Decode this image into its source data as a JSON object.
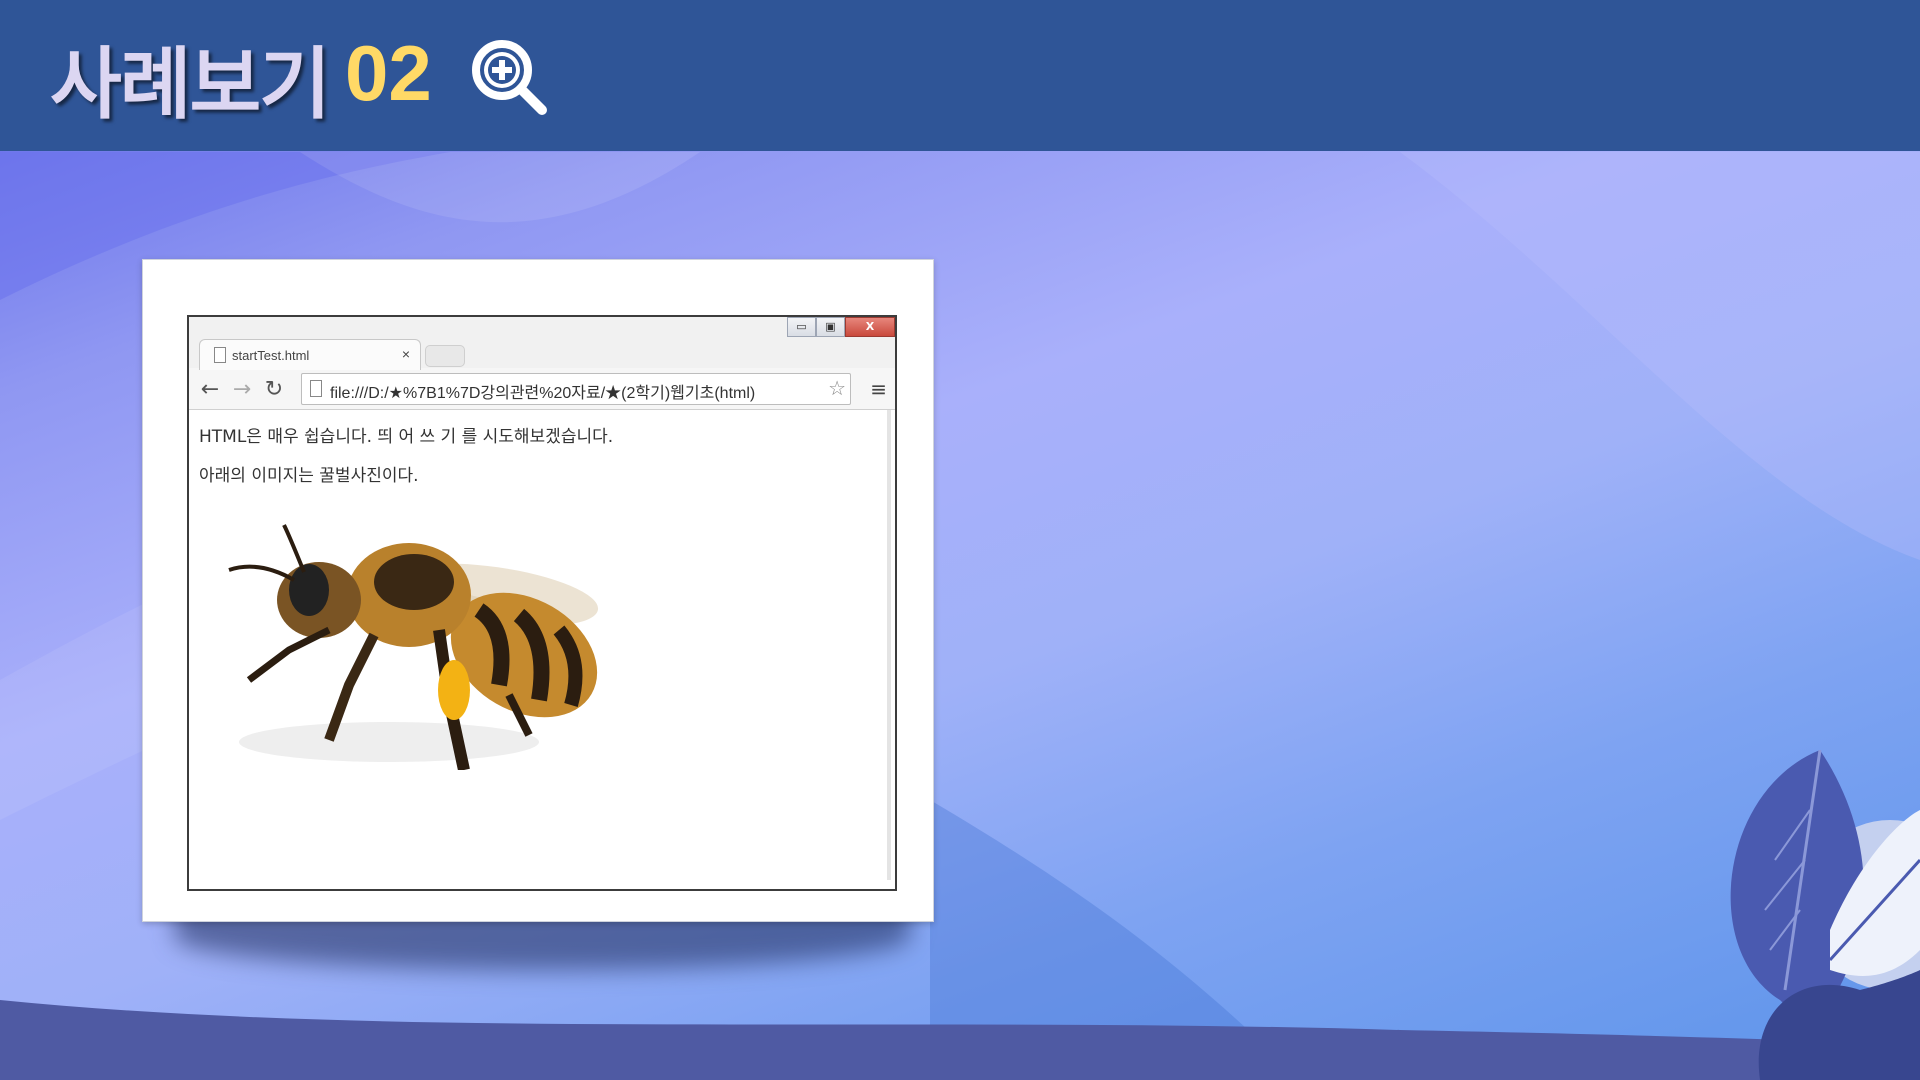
{
  "header": {
    "title": "사례보기",
    "number": "02",
    "colors": {
      "bar": "#2f5597",
      "title": "#dcd6f2",
      "number": "#ffd966"
    }
  },
  "browser": {
    "tab_title": "startTest.html",
    "tab_close": "×",
    "url": "file:///D:/★%7B1%7D강의관련%20자료/★(2학기)웹기초(html)",
    "window_buttons": {
      "minimize": "▭",
      "maximize": "▣",
      "close": "X"
    },
    "nav": {
      "back": "←",
      "forward": "→",
      "reload": "↻",
      "bookmark": "☆",
      "menu": "≡"
    }
  },
  "page_content": {
    "line1": "HTML은 매우 쉽습니다. 띄 어 쓰 기 를 시도해보겠습니다.",
    "line2": "아래의 이미지는 꿀벌사진이다."
  }
}
